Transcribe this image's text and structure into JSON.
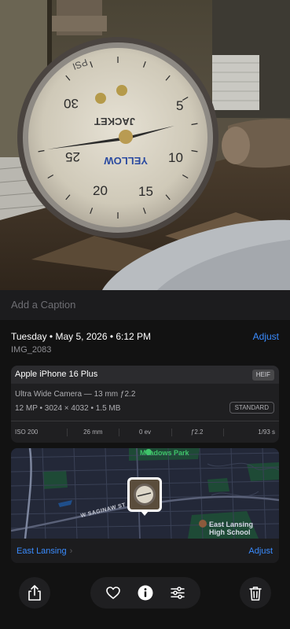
{
  "photo": {
    "gauge_dial_text": [
      "JACKET",
      "YELLOW"
    ],
    "gauge_unit": "PSI",
    "gauge_numbers": [
      "5",
      "10",
      "15",
      "20",
      "25",
      "30"
    ]
  },
  "caption": {
    "placeholder": "Add a Caption"
  },
  "info": {
    "date_time": "Tuesday • May 5, 2026 • 6:12 PM",
    "adjust_label": "Adjust",
    "filename": "IMG_2083"
  },
  "camera_card": {
    "device": "Apple iPhone 16 Plus",
    "format": "HEIF",
    "lens": "Ultra Wide Camera — 13 mm ƒ2.2",
    "specs": "12 MP • 3024 × 4032 • 1.5 MB",
    "profile_badge": "STANDARD",
    "exif": {
      "iso": "ISO 200",
      "focal_length": "26 mm",
      "exposure": "0 ev",
      "aperture": "ƒ2.2",
      "shutter": "1/93 s"
    }
  },
  "map_card": {
    "park_label": "Meadows Park",
    "street_label": "W SAGINAW ST",
    "school_label_1": "East Lansing",
    "school_label_2": "High School",
    "location": "East Lansing",
    "adjust_label": "Adjust"
  },
  "toolbar": {
    "icons": [
      "share-icon",
      "heart-icon",
      "info-icon",
      "sliders-icon",
      "trash-icon"
    ]
  },
  "colors": {
    "accent": "#3a8cff",
    "panel": "#121212",
    "card": "#1f1f21",
    "park_green": "#3fc46a"
  }
}
